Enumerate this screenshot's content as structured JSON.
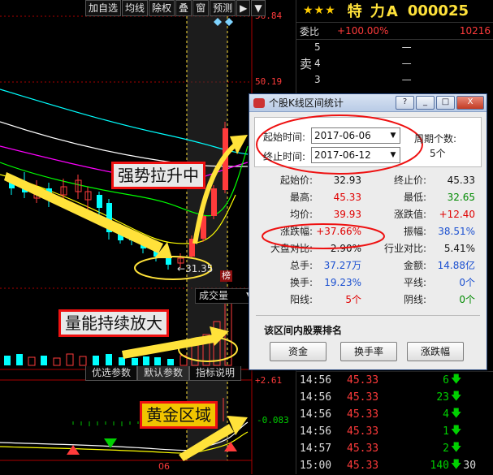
{
  "toolbar": {
    "buttons": [
      "加自选",
      "均线",
      "除权",
      "叠",
      "窗",
      "预测",
      "▶",
      "▼"
    ]
  },
  "chart": {
    "price_labels": {
      "top": "56.84",
      "mid": "50.19",
      "low_mark": "31.35"
    },
    "annotations": {
      "strong_rise": "强势拉升中",
      "volume_up": "量能持续放大",
      "golden_zone": "黄金区域"
    },
    "volume_label": "成交量",
    "bang_label": "榜",
    "tabs": [
      "优选参数",
      "默认参数",
      "指标说明"
    ],
    "indicator_values": {
      "top": "+2.61",
      "mid": "-0.083"
    },
    "date_label": "06"
  },
  "right": {
    "stars": "★★★",
    "name": "特 力A",
    "code": "000025",
    "weibi_label": "委比",
    "weibi_value": "+100.00%",
    "weibi_count": "10216",
    "sell_label": "卖",
    "orderbook": [
      {
        "level": "5",
        "price": "—",
        "vol": ""
      },
      {
        "level": "4",
        "price": "—",
        "vol": ""
      },
      {
        "level": "3",
        "price": "—",
        "vol": ""
      }
    ],
    "trades": [
      {
        "time": "14:56",
        "price": "45.33",
        "vol": "6"
      },
      {
        "time": "14:56",
        "price": "45.33",
        "vol": "23"
      },
      {
        "time": "14:56",
        "price": "45.33",
        "vol": "4"
      },
      {
        "time": "14:56",
        "price": "45.33",
        "vol": "1"
      },
      {
        "time": "14:57",
        "price": "45.33",
        "vol": "2"
      },
      {
        "time": "15:00",
        "price": "45.33",
        "vol": "140"
      }
    ],
    "last_trade_suffix": "30",
    "colors": {
      "up": "#ff3b3b",
      "down": "#00d000",
      "gold": "#ffe23a"
    }
  },
  "dialog": {
    "title": "个股K线区间统计",
    "start_label": "起始时间:",
    "start_value": "2017-06-06",
    "end_label": "终止时间:",
    "end_value": "2017-06-12",
    "period_label": "周期个数:",
    "period_value": "5个",
    "stats": [
      {
        "l1": "起始价:",
        "v1": "32.93",
        "c1": "black",
        "l2": "终止价:",
        "v2": "45.33",
        "c2": "black"
      },
      {
        "l1": "最高:",
        "v1": "45.33",
        "c1": "red",
        "l2": "最低:",
        "v2": "32.65",
        "c2": "green"
      },
      {
        "l1": "均价:",
        "v1": "39.93",
        "c1": "red",
        "l2": "涨跌值:",
        "v2": "+12.40",
        "c2": "red"
      },
      {
        "l1": "涨跌幅:",
        "v1": "+37.66%",
        "c1": "red",
        "l2": "振幅:",
        "v2": "38.51%",
        "c2": "blue"
      },
      {
        "l1": "大盘对比:",
        "v1": "2.90%",
        "c1": "black",
        "l2": "行业对比:",
        "v2": "5.41%",
        "c2": "black"
      },
      {
        "l1": "总手:",
        "v1": "37.27万",
        "c1": "blue",
        "l2": "金额:",
        "v2": "14.88亿",
        "c2": "blue"
      },
      {
        "l1": "换手:",
        "v1": "19.23%",
        "c1": "blue",
        "l2": "平线:",
        "v2": "0个",
        "c2": "blue"
      },
      {
        "l1": "阳线:",
        "v1": "5个",
        "c1": "red",
        "l2": "阴线:",
        "v2": "0个",
        "c2": "green"
      }
    ],
    "rank_title": "该区间内股票排名",
    "rank_buttons": [
      "资金",
      "换手率",
      "涨跌幅"
    ],
    "title_buttons": [
      "?",
      "_",
      "□",
      "X"
    ]
  }
}
